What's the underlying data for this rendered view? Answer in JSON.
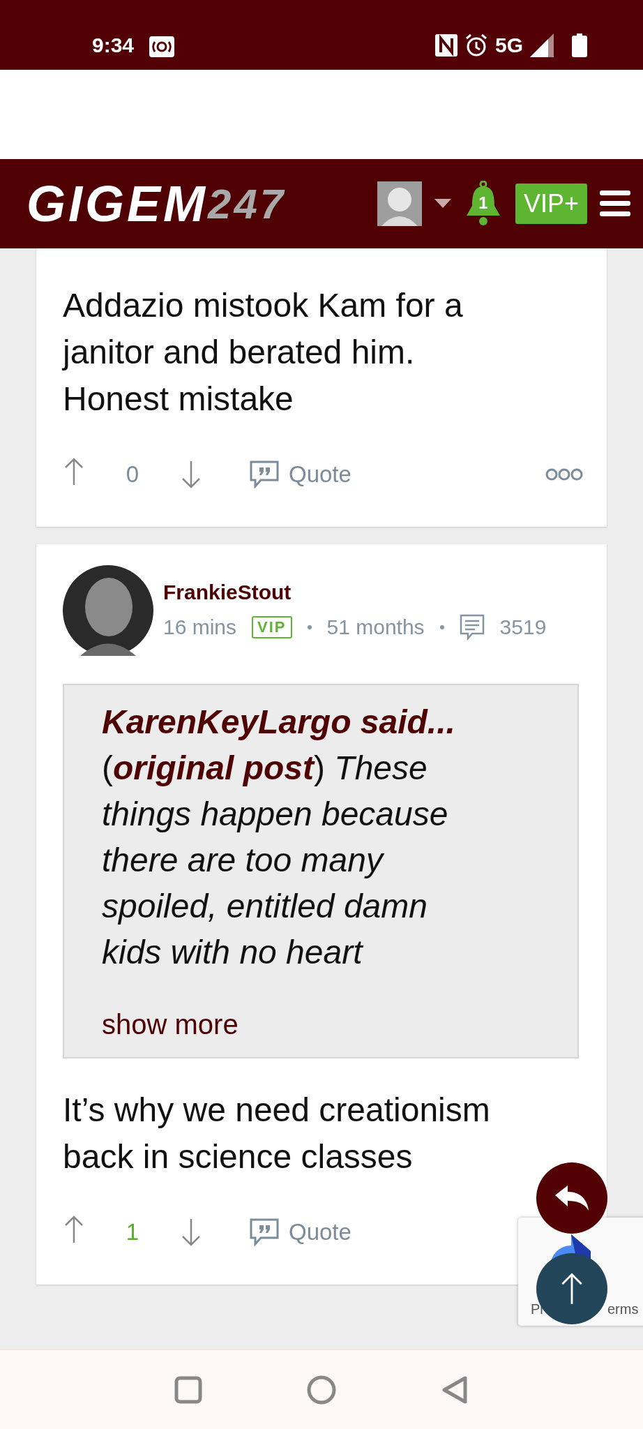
{
  "status_bar": {
    "time": "9:34",
    "network": "5G"
  },
  "header": {
    "logo": {
      "main": "GIGEM",
      "accent": "247"
    },
    "notification_count": "1",
    "vip_button": "VIP+"
  },
  "posts": [
    {
      "body": "Addazio mistook Kam for a janitor and berated him. Honest mistake",
      "votes": "0",
      "voted": false,
      "quote_label": "Quote",
      "has_menu": true
    },
    {
      "author": "FrankieStout",
      "time": "16 mins",
      "badge": "VIP",
      "tenure": "51 months",
      "post_count": "3519",
      "quote": {
        "attribution": "KarenKeyLargo said...",
        "text": "(**original post**) *These things happen because there are too many spoiled, entitled damn kids with no heart*",
        "show_more": "show more"
      },
      "body": "It’s why we need creationism back in science classes",
      "votes": "1",
      "voted": true,
      "quote_label": "Quote"
    }
  ],
  "captcha_badge": {
    "visible_text": [
      "Pr",
      "erms"
    ]
  }
}
